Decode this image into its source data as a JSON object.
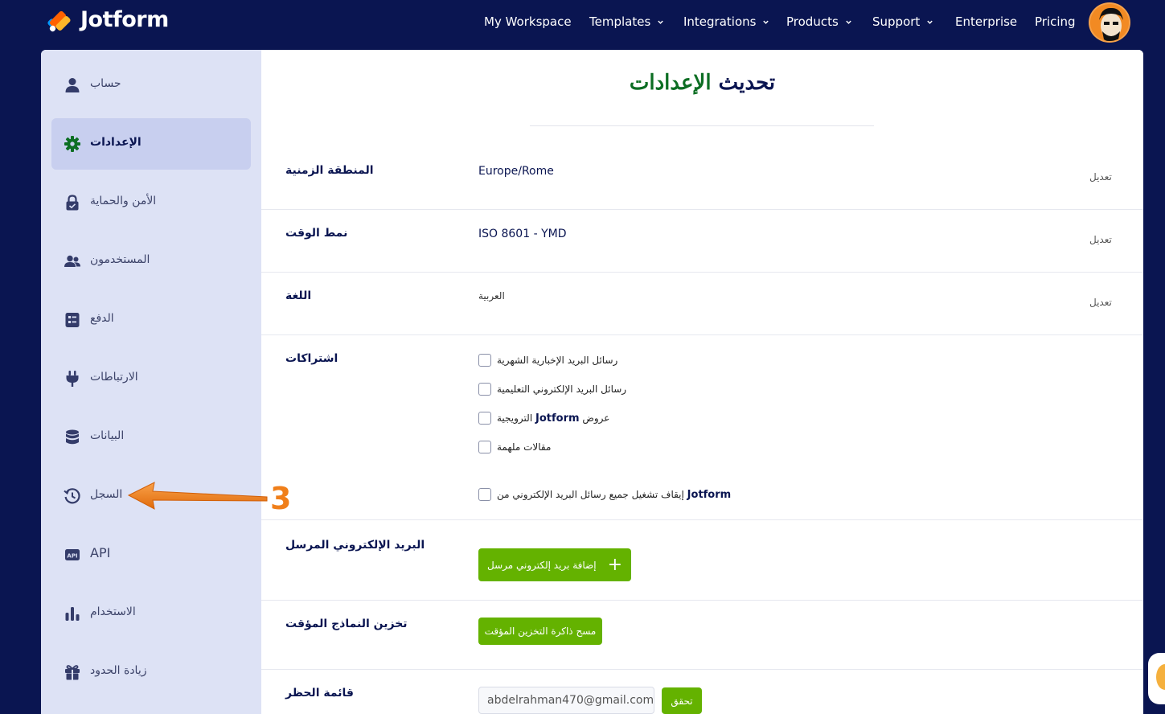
{
  "app": {
    "logo_text": "Jotform",
    "brand_color": "#0a1551",
    "accent_green": "#64b200"
  },
  "nav": {
    "items": [
      {
        "label": "My Workspace",
        "dropdown": false
      },
      {
        "label": "Templates",
        "dropdown": true
      },
      {
        "label": "Integrations",
        "dropdown": true
      },
      {
        "label": "Products",
        "dropdown": true
      },
      {
        "label": "Support",
        "dropdown": true
      },
      {
        "label": "Enterprise",
        "dropdown": false
      },
      {
        "label": "Pricing",
        "dropdown": false
      }
    ]
  },
  "sidebar": {
    "items": [
      {
        "label": "حساب",
        "icon": "user-icon",
        "active": false
      },
      {
        "label": "الإعدادات",
        "icon": "gear-icon",
        "active": true
      },
      {
        "label": "الأمن والحماية",
        "icon": "lock-icon",
        "active": false
      },
      {
        "label": "المستخدمون",
        "icon": "users-icon",
        "active": false
      },
      {
        "label": "الدفع",
        "icon": "invoice-icon",
        "active": false
      },
      {
        "label": "الارتباطات",
        "icon": "plug-icon",
        "active": false
      },
      {
        "label": "البيانات",
        "icon": "database-icon",
        "active": false
      },
      {
        "label": "السجل",
        "icon": "history-icon",
        "active": false
      },
      {
        "label": "API",
        "icon": "api-icon",
        "active": false
      },
      {
        "label": "الاستخدام",
        "icon": "bar-chart-icon",
        "active": false
      },
      {
        "label": "زيادة الحدود",
        "icon": "gift-icon",
        "active": false
      }
    ]
  },
  "main": {
    "title_part1": "تحديث",
    "title_part2": "الإعدادات",
    "timezone": {
      "label": "المنطقة الزمنية",
      "value": "Europe/Rome",
      "edit": "تعديل"
    },
    "time_format": {
      "label": "نمط الوقت",
      "value": "ISO 8601 - YMD",
      "edit": "تعديل"
    },
    "language": {
      "label": "اللغة",
      "value": "العربية",
      "edit": "تعديل"
    },
    "subscriptions": {
      "label": "اشتراكات",
      "options": [
        {
          "text": "رسائل البريد الإخبارية الشهرية",
          "checked": false
        },
        {
          "text": "رسائل البريد الإلكتروني التعليمية",
          "checked": false
        },
        {
          "text_pre": "الترويجية",
          "text_brand": "Jotform",
          "text_post": "عروض",
          "checked": false
        },
        {
          "text": "مقالات ملهمة",
          "checked": false
        }
      ],
      "unsubscribe_pre": "إيقاف تشغيل جميع رسائل البريد الإلكتروني من",
      "unsubscribe_brand": "Jotform"
    },
    "sender_email": {
      "label": "البريد الإلكتروني المرسل",
      "button": "إضافة بريد إلكتروني مرسل"
    },
    "form_cache": {
      "label": "تخزين النماذج المؤقت",
      "button": "مسح ذاكرة التخزين المؤقت"
    },
    "blocklist": {
      "label": "قائمة الحظر",
      "input_value": "abdelrahman470@gmail.com",
      "button": "تحقق"
    }
  },
  "annotation": {
    "step_number": "3",
    "arrow_color": "#f07f1a"
  }
}
